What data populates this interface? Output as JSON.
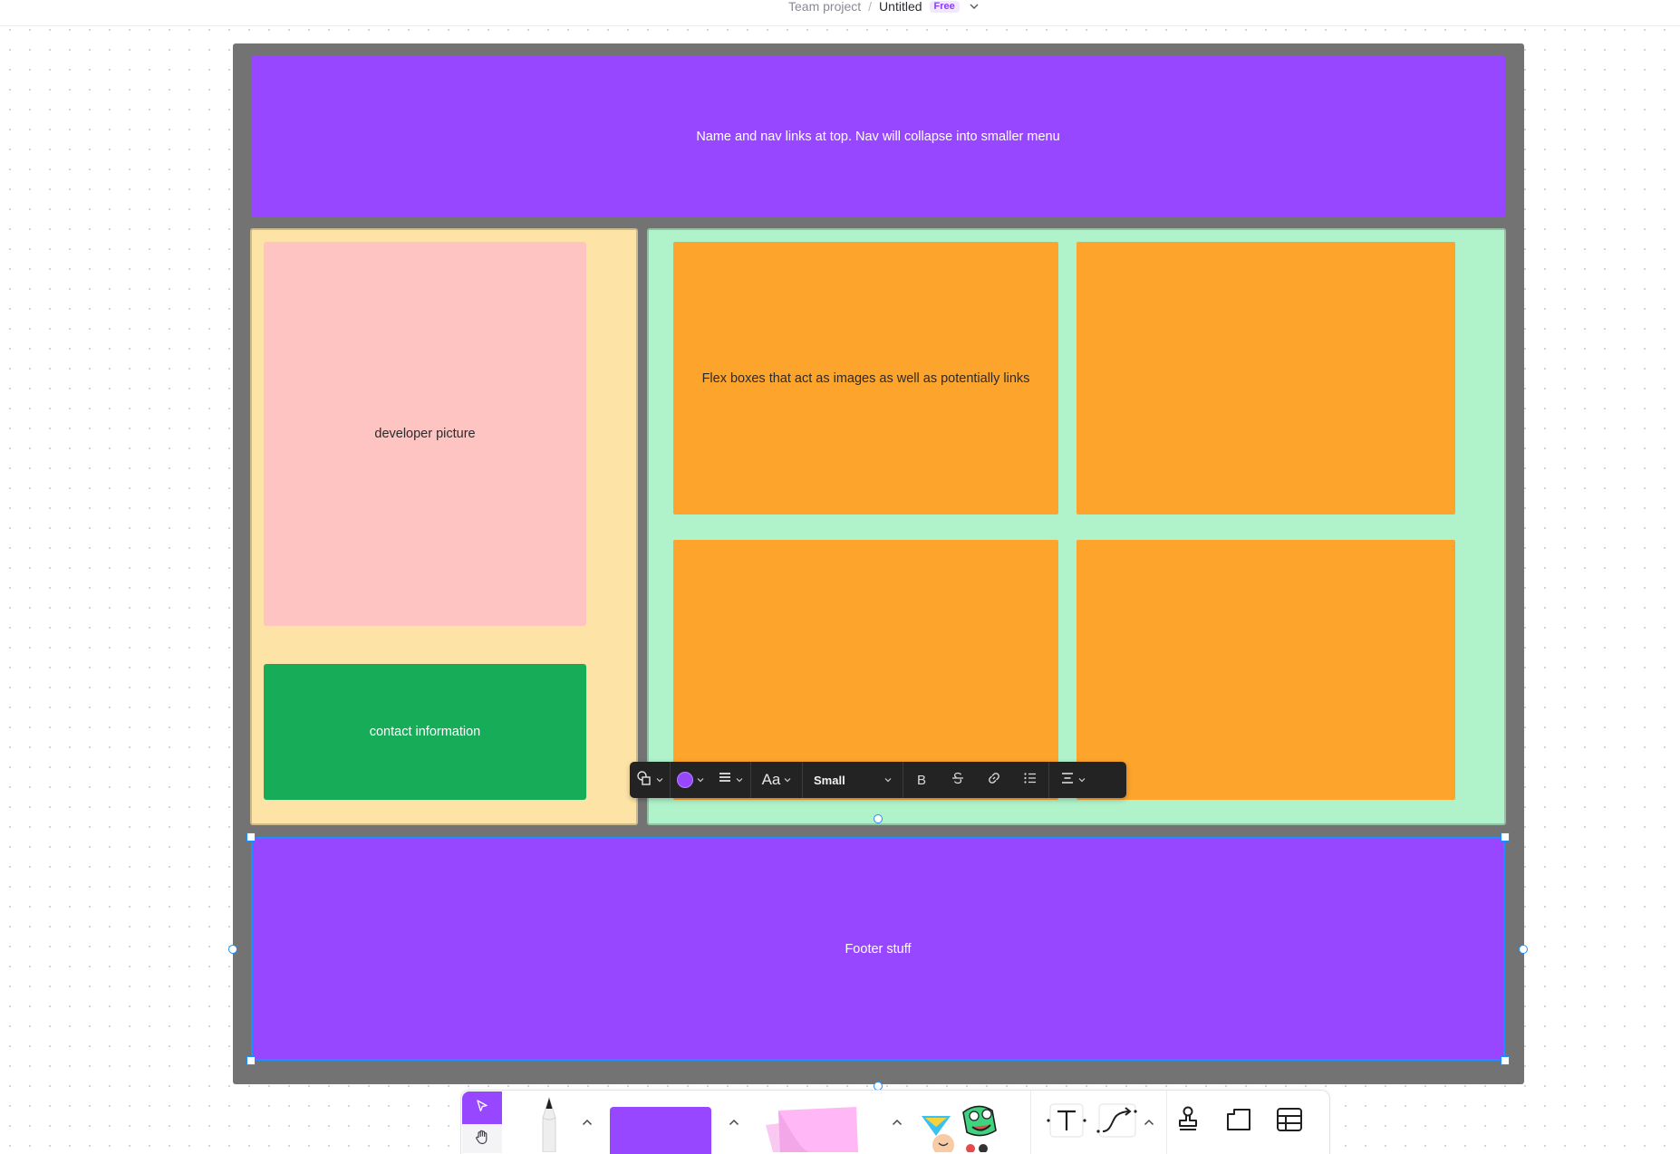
{
  "topbar": {
    "breadcrumb_team": "Team project",
    "breadcrumb_separator": "/",
    "file_name": "Untitled",
    "plan_badge": "Free"
  },
  "canvas": {
    "header_text": "Name and nav links at top. Nav will collapse into smaller menu",
    "developer_picture_text": "developer picture",
    "contact_text": "contact information",
    "flexbox_text": "Flex boxes that act as images as well as potentially links",
    "footer_text": "Footer stuff",
    "colors": {
      "frame": "#737373",
      "header": "#9747ff",
      "left_column": "#fde4a6",
      "developer_picture": "#fdc4c1",
      "contact": "#17ad58",
      "right_column": "#b0f2c9",
      "tiles": "#fca42c",
      "footer": "#9747ff",
      "selection": "#1d8fff"
    }
  },
  "format_toolbar": {
    "shape_icon": "shapes-icon",
    "fill_color": "#9747ff",
    "alignment_icon": "align-lines-icon",
    "font_label": "Aa",
    "text_size": "Small",
    "bold_label": "B",
    "strike_icon": "strikethrough-icon",
    "link_icon": "link-icon",
    "list_icon": "list-icon",
    "text_align_icon": "text-align-center-icon"
  },
  "dock": {
    "tools": [
      "select-tool",
      "hand-tool",
      "pen-tool",
      "shape-tool",
      "sticky-tool",
      "stickers",
      "text-tool",
      "connector-tool",
      "stamp-tool",
      "section-tool",
      "table-tool"
    ],
    "shape_color": "#9747ff",
    "sticky_color": "#ffb8f5"
  }
}
